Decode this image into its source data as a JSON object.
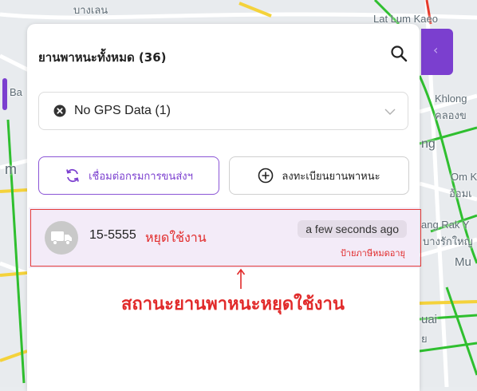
{
  "map": {
    "labels": [
      "บางเลน",
      "Lat Lum Kaeo",
      "Ba",
      "Khlong",
      "คลองข",
      "ng",
      "m",
      "Om K",
      "อ้อมเ",
      "ang Rak Y",
      "บางรักใหญ",
      "Mu",
      "uai",
      "ย"
    ]
  },
  "panel": {
    "title": "ยานพาหนะทั้งหมด (36)",
    "filter": {
      "selected": "No GPS Data (1)"
    },
    "buttons": {
      "connect": "เชื่อมต่อกรมการขนส่งฯ",
      "register": "ลงทะเบียนยานพาหนะ"
    },
    "vehicles": [
      {
        "plate": "15-5555",
        "status": "หยุดใช้งาน",
        "time": "a few seconds ago",
        "tax_status": "ป้ายภาษีหมดอายุ"
      }
    ]
  },
  "annotation": {
    "text": "สถานะยานพาหนะหยุดใช้งาน"
  },
  "colors": {
    "accent": "#7b3fcf",
    "status_red": "#e12a2a",
    "item_bg": "#f3ebf8"
  }
}
